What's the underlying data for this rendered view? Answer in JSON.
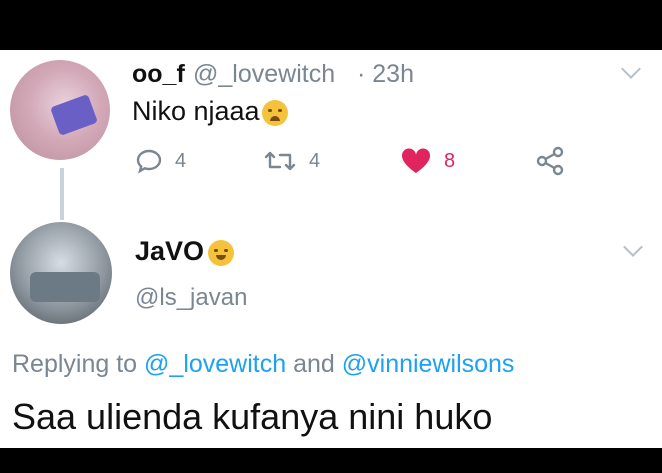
{
  "tweet": {
    "author_name": "oo_f",
    "handle": "@_lovewitch",
    "time": "· 23h",
    "text": "Niko njaaa",
    "emoji": "crying-face-emoji",
    "reply_count": "4",
    "retweet_count": "4",
    "like_count": "8",
    "colors": {
      "like": "#e0245e",
      "muted": "#7a8691",
      "link": "#1da1f2"
    }
  },
  "reply": {
    "author_name": "JaVO",
    "emoji": "smiling-face-emoji",
    "handle": "@ls_javan",
    "replying_prefix": "Replying to",
    "mention_1": "@_lovewitch",
    "conjunction": "and",
    "mention_2": "@vinniewilsons",
    "text": "Saa ulienda kufanya nini huko"
  }
}
